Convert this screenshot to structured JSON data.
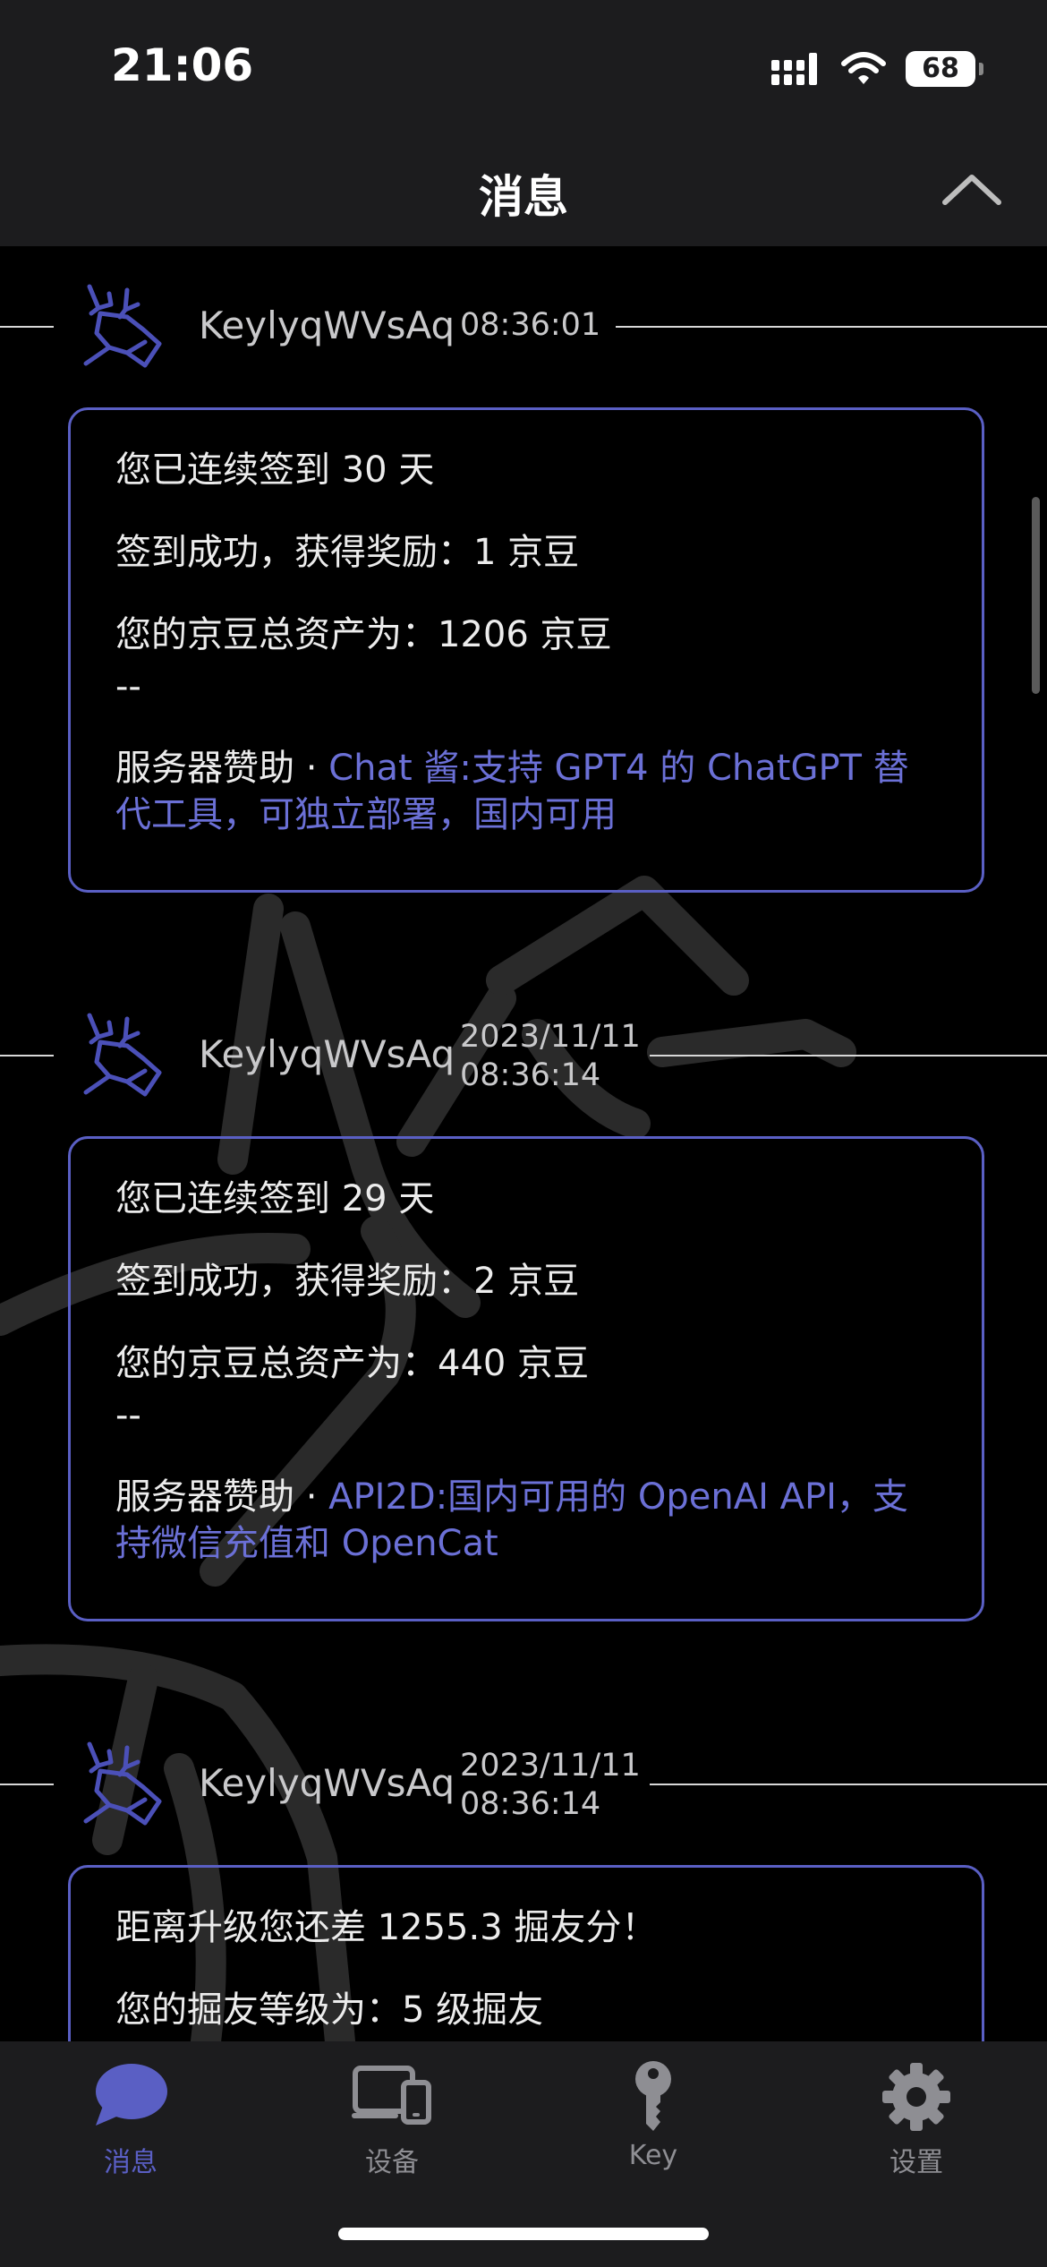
{
  "status_bar": {
    "time": "21:06",
    "battery": "68"
  },
  "nav": {
    "title": "消息"
  },
  "messages": [
    {
      "sender": "KeylyqWVsAq",
      "time": "08:36:01",
      "lines": [
        "您已连续签到 30 天",
        "签到成功，获得奖励：1 京豆",
        "您的京豆总资产为：1206 京豆"
      ],
      "separator": "--",
      "sponsor_prefix": "服务器赞助 · ",
      "sponsor_link": "Chat 酱:支持 GPT4 的 ChatGPT 替代工具，可独立部署，国内可用"
    },
    {
      "sender": "KeylyqWVsAq",
      "date": "2023/11/11",
      "time": "08:36:14",
      "lines": [
        "您已连续签到 29 天",
        "签到成功，获得奖励：2 京豆",
        "您的京豆总资产为：440 京豆"
      ],
      "separator": "--",
      "sponsor_prefix": "服务器赞助 · ",
      "sponsor_link": "API2D:国内可用的 OpenAI API，支持微信充值和 OpenCat"
    },
    {
      "sender": "KeylyqWVsAq",
      "date": "2023/11/11",
      "time": "08:36:14",
      "lines": [
        "距离升级您还差 1255.3 掘友分！",
        "您的掘友等级为：5 级掘友"
      ]
    }
  ],
  "tabs": [
    {
      "label": "消息",
      "icon": "chat-bubble-icon",
      "active": true
    },
    {
      "label": "设备",
      "icon": "devices-icon",
      "active": false
    },
    {
      "label": "Key",
      "icon": "key-icon",
      "active": false
    },
    {
      "label": "设置",
      "icon": "gear-icon",
      "active": false
    }
  ],
  "colors": {
    "accent": "#5a5fc4",
    "link": "#6b70d6",
    "bar_bg": "#1c1c1e"
  }
}
